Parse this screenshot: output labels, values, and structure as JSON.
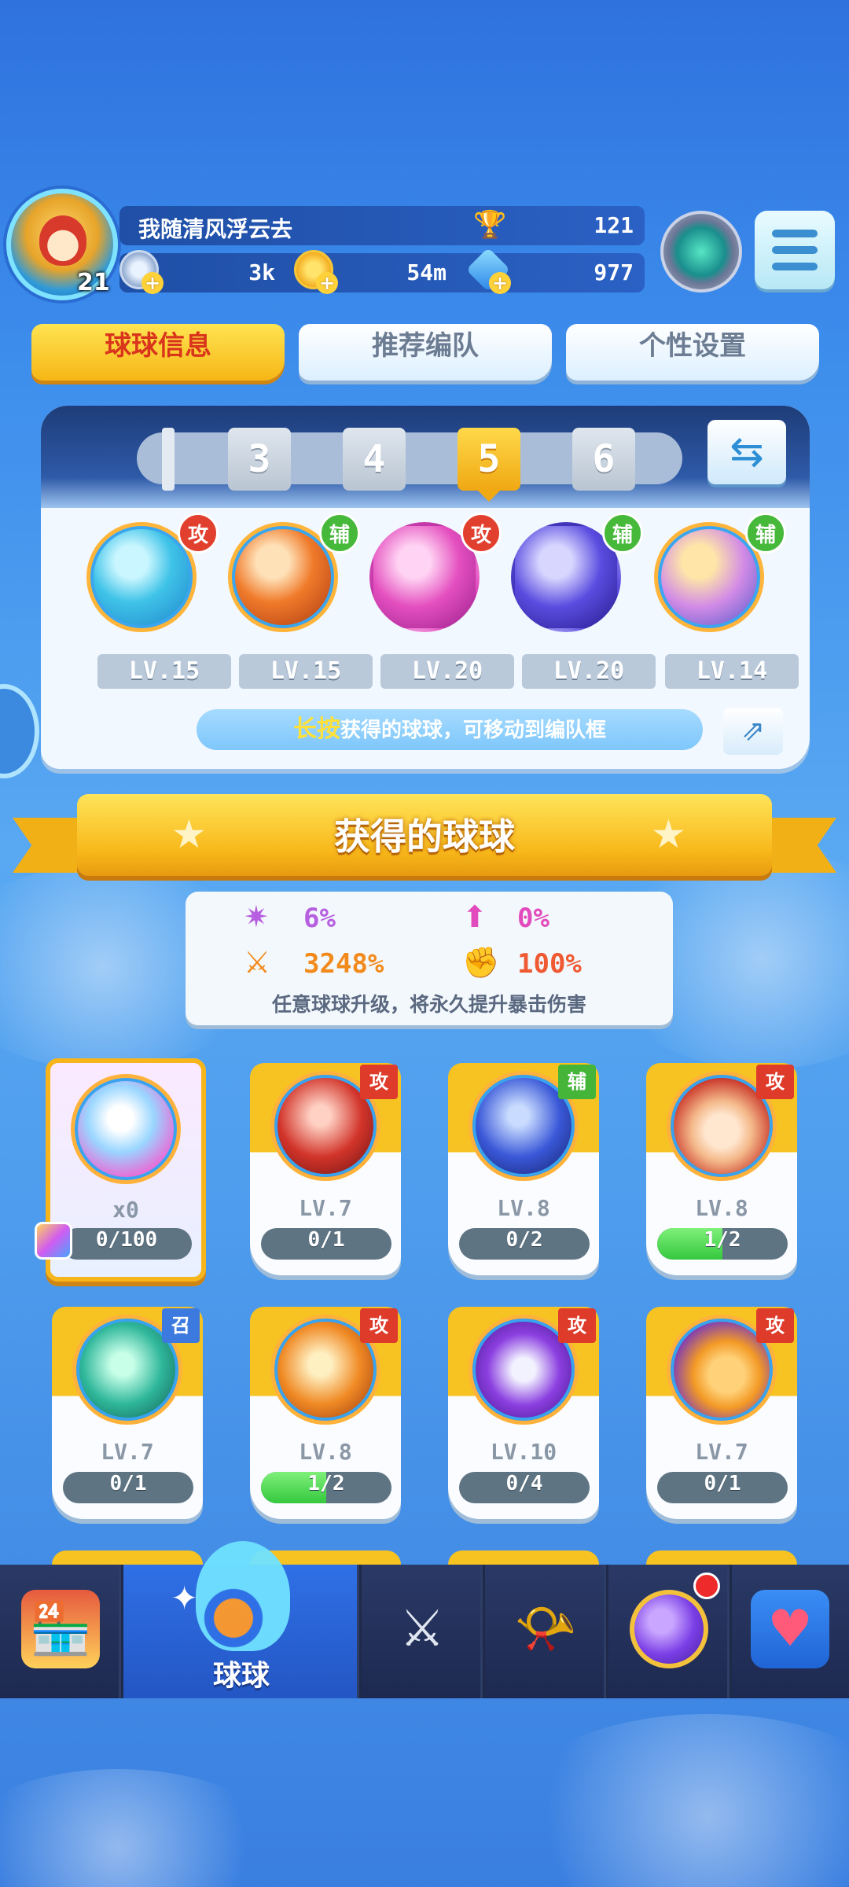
{
  "header": {
    "player_name": "我随清风浮云去",
    "player_level": "21",
    "trophies": "121",
    "resources": [
      {
        "icon": "energy-icon",
        "value": "3k"
      },
      {
        "icon": "gold-coin-icon",
        "value": "54m"
      },
      {
        "icon": "diamond-icon",
        "value": "977"
      }
    ],
    "menu_icon": "hamburger-menu-icon"
  },
  "tabs": [
    {
      "label": "球球信息",
      "active": true
    },
    {
      "label": "推荐编队",
      "active": false
    },
    {
      "label": "个性设置",
      "active": false
    }
  ],
  "team": {
    "slots": [
      "3",
      "4",
      "5",
      "6"
    ],
    "active_slot": "5",
    "balls": [
      {
        "tag": "攻",
        "level": "LV.15",
        "color": "#3fc3e8"
      },
      {
        "tag": "辅",
        "level": "LV.15",
        "color": "#f07a2a"
      },
      {
        "tag": "攻",
        "level": "LV.20",
        "color": "#e44fbf"
      },
      {
        "tag": "辅",
        "level": "LV.20",
        "color": "#5a4de0"
      },
      {
        "tag": "辅",
        "level": "LV.14",
        "color": "#d28be6"
      }
    ],
    "hint_key": "长按",
    "hint_text": "获得的球球，可移动到编队框"
  },
  "banner": {
    "title": "获得的球球"
  },
  "stats": {
    "items": [
      {
        "icon": "crit-rate-icon",
        "value": "6%",
        "color": "#b65fe0"
      },
      {
        "icon": "crit-boost-icon",
        "value": "0%",
        "color": "#e24bbd"
      },
      {
        "icon": "damage-icon",
        "value": "3248%",
        "color": "#f28a1c"
      },
      {
        "icon": "power-fist-icon",
        "value": "100%",
        "color": "#ef5a33"
      }
    ],
    "note": "任意球球升级，将永久提升暴击伤害"
  },
  "cards": [
    {
      "type": "special",
      "label": "x0",
      "progress": "0/100",
      "fraction": 0,
      "color": "#9ad6ff"
    },
    {
      "tag": "攻",
      "tag_kind": "atk",
      "level": "LV.7",
      "progress": "0/1",
      "fraction": 0,
      "color": "#d2342a"
    },
    {
      "tag": "辅",
      "tag_kind": "sup",
      "level": "LV.8",
      "progress": "0/2",
      "fraction": 0,
      "color": "#3a58d8"
    },
    {
      "tag": "攻",
      "tag_kind": "atk",
      "level": "LV.8",
      "progress": "1/2",
      "fraction": 0.5,
      "color": "#f4b889"
    },
    {
      "tag": "召",
      "tag_kind": "sum",
      "level": "LV.7",
      "progress": "0/1",
      "fraction": 0,
      "color": "#2fb79a"
    },
    {
      "tag": "攻",
      "tag_kind": "atk",
      "level": "LV.8",
      "progress": "1/2",
      "fraction": 0.5,
      "color": "#f08a25"
    },
    {
      "tag": "攻",
      "tag_kind": "atk",
      "level": "LV.10",
      "progress": "0/4",
      "fraction": 0,
      "color": "#8b3fe0"
    },
    {
      "tag": "攻",
      "tag_kind": "atk",
      "level": "LV.7",
      "progress": "0/1",
      "fraction": 0,
      "color": "#f39a26"
    }
  ],
  "nav": {
    "items": [
      {
        "name": "shop",
        "icon": "shop-icon",
        "label": ""
      },
      {
        "name": "balls",
        "icon": "balls-icon",
        "label": "球球",
        "active": true
      },
      {
        "name": "battle",
        "icon": "crossed-swords-icon",
        "label": ""
      },
      {
        "name": "whistle",
        "icon": "whistle-icon",
        "label": ""
      },
      {
        "name": "planet",
        "icon": "planet-icon",
        "label": "",
        "badge": true
      },
      {
        "name": "social",
        "icon": "heart-message-icon",
        "label": ""
      }
    ]
  }
}
